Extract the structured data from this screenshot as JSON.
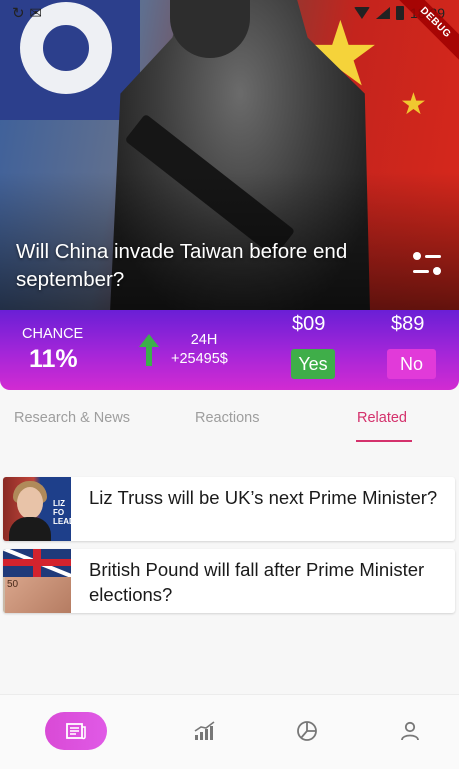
{
  "status_bar": {
    "time": "18:29",
    "debug_label": "DEBUG"
  },
  "hero": {
    "title": "Will China invade Taiwan before end september?",
    "image": "soldier-with-taiwan-and-china-flags"
  },
  "market": {
    "chance_label": "CHANCE",
    "chance_value": "11%",
    "trend_icon": "arrow-up-icon",
    "trend_color": "#3cb04a",
    "period_label": "24H",
    "volume_change": "+25495$",
    "yes_price": "$09",
    "no_price": "$89",
    "yes_label": "Yes",
    "no_label": "No",
    "yes_color": "#3fae49",
    "no_color": "#e13ad9"
  },
  "tabs": {
    "items": [
      {
        "label": "Research & News",
        "active": false
      },
      {
        "label": "Reactions",
        "active": false
      },
      {
        "label": "Related",
        "active": true
      }
    ],
    "active_color": "#d4316c"
  },
  "related": [
    {
      "title": "Liz Truss will be UK’s next Prime Minister?",
      "thumb": "liz-truss-photo",
      "thumb_text": "LIZ FO\nLEAD"
    },
    {
      "title": "British Pound will fall after Prime Minister elections?",
      "thumb": "uk-flag-pound-notes",
      "thumb_text": "50"
    }
  ],
  "bottom_nav": {
    "items": [
      {
        "icon": "news-icon",
        "active": true
      },
      {
        "icon": "stats-chart-icon",
        "active": false
      },
      {
        "icon": "pie-chart-icon",
        "active": false
      },
      {
        "icon": "user-icon",
        "active": false
      }
    ],
    "active_color": "#d94ad6"
  }
}
